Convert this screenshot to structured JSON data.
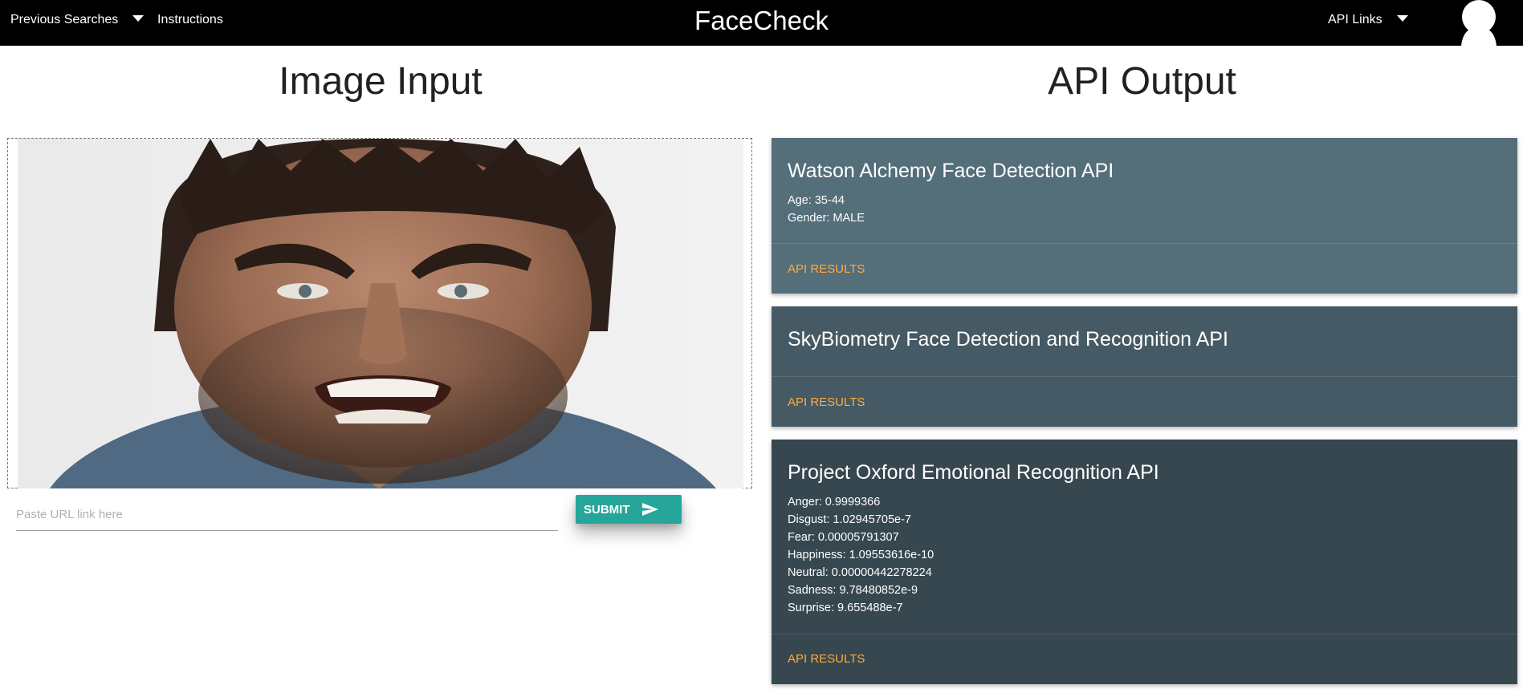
{
  "nav": {
    "previous_searches": "Previous Searches",
    "instructions": "Instructions",
    "brand": "FaceCheck",
    "api_links": "API Links"
  },
  "image_input": {
    "title": "Image Input",
    "url_placeholder": "Paste URL link here",
    "url_value": "",
    "submit_label": "SUBMIT"
  },
  "api_output": {
    "title": "API Output",
    "cards": [
      {
        "title": "Watson Alchemy Face Detection API",
        "lines": [
          "Age: 35-44",
          "Gender: MALE"
        ],
        "link": "API RESULTS",
        "color": "#546e7a"
      },
      {
        "title": "SkyBiometry Face Detection and Recognition API",
        "lines": [],
        "link": "API RESULTS",
        "color": "#455a64"
      },
      {
        "title": "Project Oxford Emotional Recognition API",
        "lines": [
          "Anger: 0.9999366",
          "Disgust: 1.02945705e-7",
          "Fear: 0.00005791307",
          "Happiness: 1.09553616e-10",
          "Neutral: 0.00000442278224",
          "Sadness: 9.78480852e-9",
          "Surprise: 9.655488e-7"
        ],
        "link": "API RESULTS",
        "color": "#37474f"
      }
    ]
  },
  "accent": {
    "submit": "#26a69a",
    "link": "#ffab40"
  }
}
